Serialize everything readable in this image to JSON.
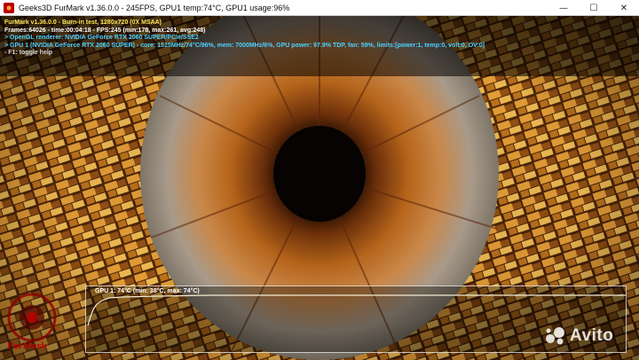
{
  "window": {
    "title": "Geeks3D FurMark v1.36.0.0 - 245FPS, GPU1 temp:74°C, GPU1 usage:96%",
    "minimize_glyph": "—",
    "maximize_glyph": "☐",
    "close_glyph": "✕"
  },
  "hud": {
    "line1": "FurMark v1.36.0.0 - Burn-in test, 1280x720 (0X MSAA)",
    "line2": "Frames:64026 - time:00:04:18 - FPS:245 (min:178, max:261, avg:248)",
    "line3": "> OpenGL renderer: NVIDIA GeForce RTX 2060 SUPER/PCIe/SSE2",
    "line4": "> GPU 1 (NVIDIA GeForce RTX 2060 SUPER) - core: 1515MHz/74°C/96%, mem: 7000MHz/6%, GPU power: 97.9% TDP, fan: 59%, limits:[power:1, temp:0, volt:0, OV:0]",
    "line5": "- F1: toggle help"
  },
  "graph": {
    "label": "GPU 1: 74°C (min: 38°C, max: 74°C)",
    "current_temp_c": 74,
    "min_temp_c": 38,
    "max_temp_c": 74
  },
  "logo_text": "FurMark",
  "watermark_text": "Avito",
  "colors": {
    "hud_title": "#ffe65c",
    "hud_info": "#4fd0ff",
    "logo_red": "#c40000"
  }
}
